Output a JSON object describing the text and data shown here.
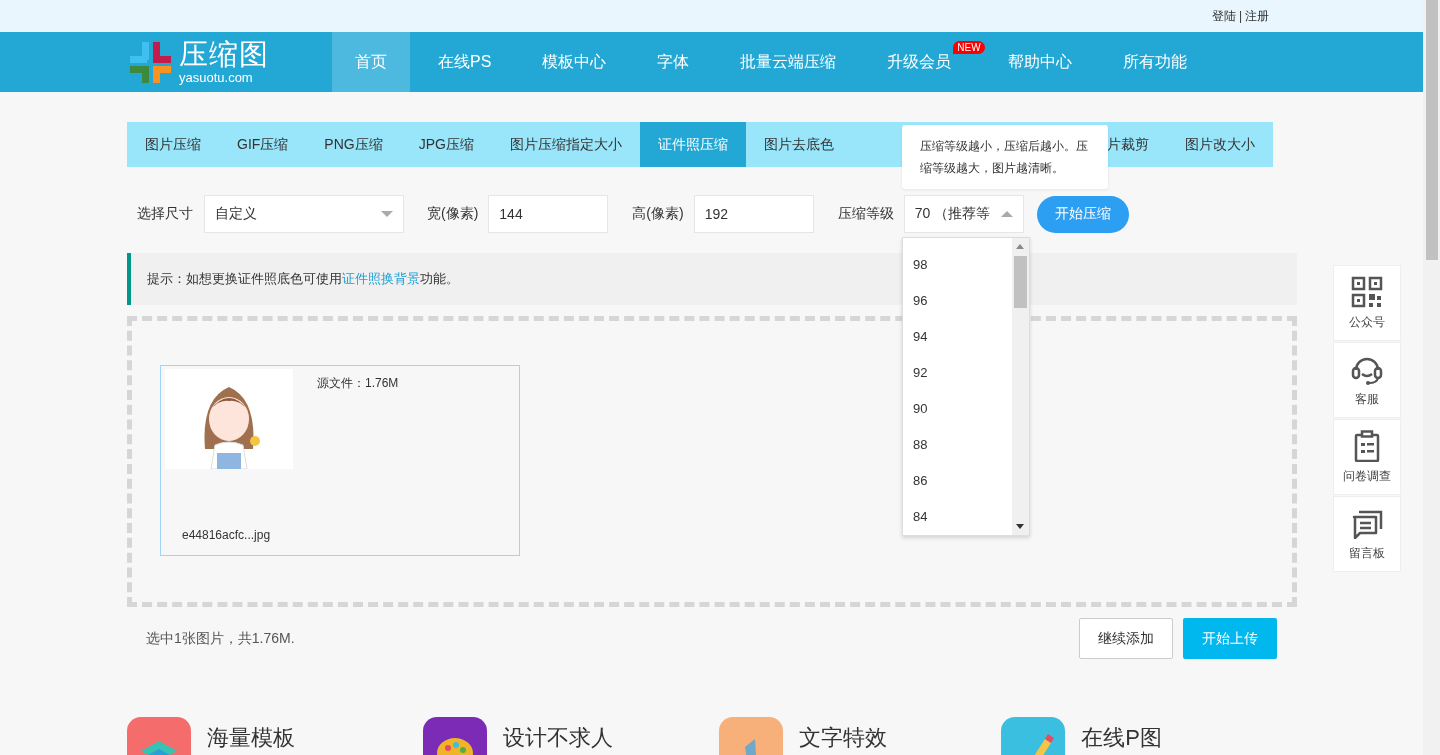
{
  "top_links": {
    "login": "登陆",
    "separator": "|",
    "register": "注册"
  },
  "logo": {
    "name": "压缩图",
    "domain": "yasuotu.com"
  },
  "nav": [
    {
      "label": "首页",
      "selected": true
    },
    {
      "label": "在线PS",
      "selected": false
    },
    {
      "label": "模板中心",
      "selected": false
    },
    {
      "label": "字体",
      "selected": false
    },
    {
      "label": "批量云端压缩",
      "selected": false
    },
    {
      "label": "升级会员",
      "selected": false,
      "badge": "NEW"
    },
    {
      "label": "帮助中心",
      "selected": false
    },
    {
      "label": "所有功能",
      "selected": false
    }
  ],
  "tool_tabs": [
    {
      "label": "图片压缩",
      "selected": false
    },
    {
      "label": "GIF压缩",
      "selected": false
    },
    {
      "label": "PNG压缩",
      "selected": false
    },
    {
      "label": "JPG压缩",
      "selected": false
    },
    {
      "label": "图片压缩指定大小",
      "selected": false
    },
    {
      "label": "证件照压缩",
      "selected": true
    },
    {
      "label": "图片去底色",
      "selected": false
    },
    {
      "label": "片裁剪",
      "selected": false,
      "kind": "partly_covered"
    },
    {
      "label": "图片改大小",
      "selected": false
    }
  ],
  "tooltip": "压缩等级越小，压缩后越小。压缩等级越大，图片越清晰。",
  "form": {
    "size_label": "选择尺寸",
    "size_value": "自定义",
    "width_label": "宽(像素)",
    "width_value": "144",
    "height_label": "高(像素)",
    "height_value": "192",
    "level_label": "压缩等级",
    "level_value": "70 （推荐等",
    "level_expanded": true,
    "submit": "开始压缩"
  },
  "level_options": [
    "98",
    "96",
    "94",
    "92",
    "90",
    "88",
    "86",
    "84"
  ],
  "tip": {
    "before": "提示：如想更换证件照底色可使用",
    "link": "证件照换背景",
    "after": "功能。"
  },
  "file": {
    "kind": "picture",
    "size": "源文件：1.76M",
    "name": "e44816acfc...jpg"
  },
  "summary": "选中1张图片，共1.76M.",
  "actions": {
    "add": "继续添加",
    "upload": "开始上传"
  },
  "side_panel": [
    {
      "label": "公众号",
      "kind": "qr"
    },
    {
      "label": "客服",
      "kind": "headset"
    },
    {
      "label": "问卷调查",
      "kind": "clipboard"
    },
    {
      "label": "留言板",
      "kind": "chat"
    }
  ],
  "features": [
    {
      "label": "海量模板",
      "color": "#f56c6c",
      "kind": "layers"
    },
    {
      "label": "设计不求人",
      "color": "#7b2bb5",
      "kind": "palette"
    },
    {
      "label": "文字特效",
      "color": "#f7b07a",
      "kind": "stroke"
    },
    {
      "label": "在线P图",
      "color": "#3bbfe0",
      "kind": "pencil"
    }
  ]
}
